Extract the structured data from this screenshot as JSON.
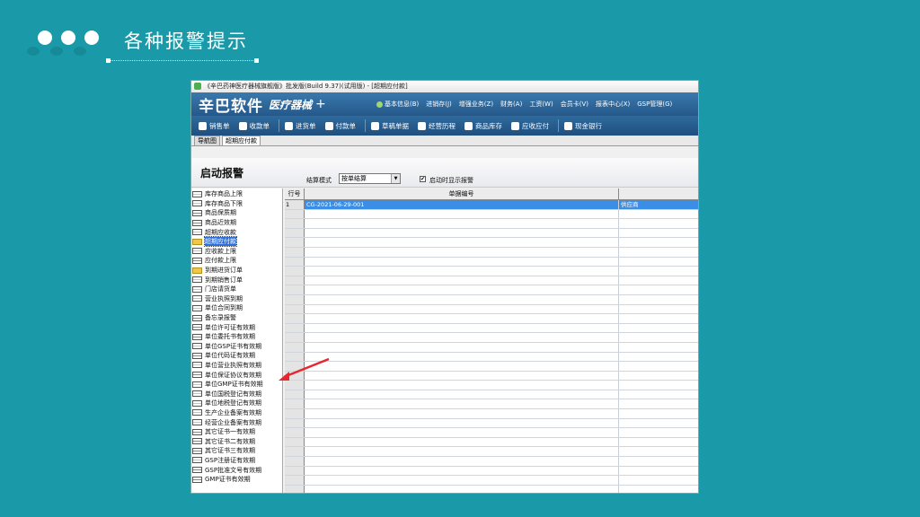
{
  "slide": {
    "title": "各种报警提示"
  },
  "window": {
    "title": "《辛巴药神医疗器械旗舰版》批发版(Build 9.37)(试用版) - [超期应付款]",
    "brand": {
      "logo": "辛巴软件",
      "product": "医疗器械",
      "plus": "+"
    },
    "menus": [
      {
        "label": "基本信息(B)",
        "icon": "leaf-icon"
      },
      {
        "label": "进销存(J)"
      },
      {
        "label": "增强业务(Z)"
      },
      {
        "label": "财务(A)"
      },
      {
        "label": "工资(W)"
      },
      {
        "label": "会员卡(V)"
      },
      {
        "label": "报表中心(X)"
      },
      {
        "label": "GSP管理(G)"
      }
    ],
    "toolbar": [
      {
        "label": "销售单",
        "icon": "tag-icon"
      },
      {
        "label": "收款单",
        "icon": "money-icon"
      },
      {
        "label": "进货单",
        "icon": "list-icon"
      },
      {
        "label": "付款单",
        "icon": "pay-icon"
      },
      {
        "label": "草稿单据",
        "icon": "draft-icon"
      },
      {
        "label": "经营历程",
        "icon": "mail-icon"
      },
      {
        "label": "商品库存",
        "icon": "camera-icon"
      },
      {
        "label": "应收应付",
        "icon": "coins-icon"
      },
      {
        "label": "现金银行",
        "icon": "hand-icon"
      }
    ],
    "tabs": [
      "导航图",
      "超期应付款"
    ],
    "panel": {
      "title": "启动报警",
      "mode_label": "结算模式",
      "mode_value": "按单结算",
      "checkbox_label": "启动时显示报警",
      "checkbox_checked": true
    },
    "tree_items": [
      "库存商品上限",
      "库存商品下限",
      "商品保质期",
      "商品近效期",
      "超期应收款",
      "超期应付款",
      "应收款上限",
      "应付款上限",
      "到期进货订单",
      "到期销售订单",
      "门店请货单",
      "营业执照到期",
      "单位合同到期",
      "备忘录报警",
      "单位许可证有效期",
      "单位委托书有效期",
      "单位GSP证书有效期",
      "单位代码证有效期",
      "单位营业执照有效期",
      "单位保证协议有效期",
      "单位GMP证书有效期",
      "单位国税登记有效期",
      "单位地税登记有效期",
      "生产企业备案有效期",
      "经营企业备案有效期",
      "其它证书一有效期",
      "其它证书二有效期",
      "其它证书三有效期",
      "GSP注册证有效期",
      "GSP批准文号有效期",
      "GMP证书有效期"
    ],
    "tree_folder_items": [
      5,
      8
    ],
    "tree_selected": 5,
    "grid": {
      "columns": [
        "行号",
        "单据编号",
        ""
      ],
      "rows": [
        {
          "no": "1",
          "doc_no": "CG-2021-06-29-001",
          "party": "供应商"
        }
      ],
      "empty_rows": 30
    }
  }
}
